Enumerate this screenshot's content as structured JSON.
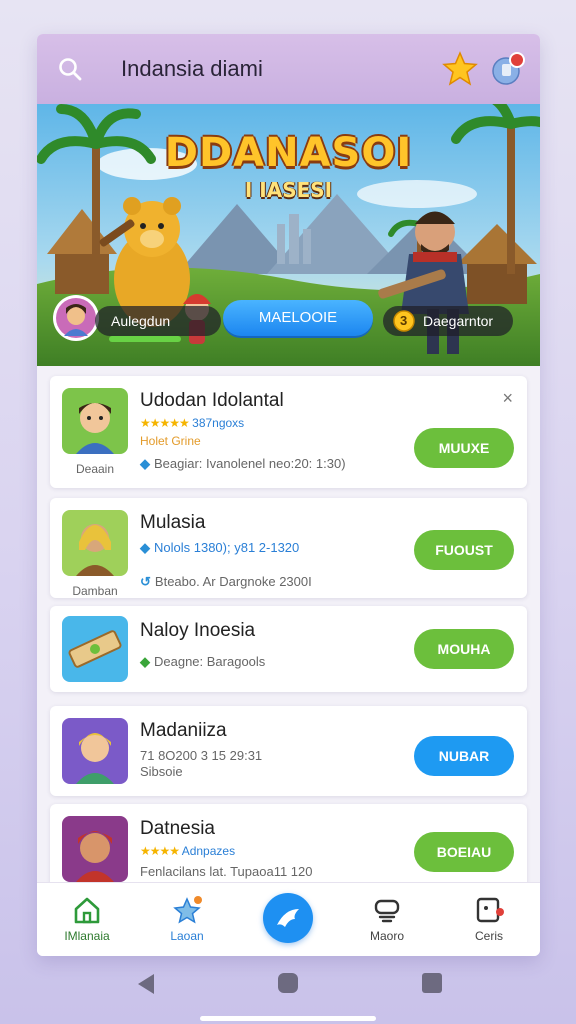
{
  "header": {
    "title": "Indansia diami",
    "search_icon": "search-icon",
    "star_icon": "star-icon",
    "badge_icon": "badge-icon"
  },
  "hero": {
    "title": "DDANASOI",
    "subtitle": "I IASESI",
    "left_pill": "Aulegdun",
    "button": "MAELOOIE",
    "right_pill": "Daegarntor",
    "coin_value": "3"
  },
  "cards": [
    {
      "title": "Udodan Idolantal",
      "rating": "387ngoxs",
      "tag": "Holet Grine",
      "meta": "Beagiar: Ivanolenel neo:20: 1:30)",
      "caption": "Deaain",
      "button": "MUUXE",
      "close": "×"
    },
    {
      "title": "Mulasia",
      "line2": "Nolols 1380); y81 2-1320",
      "meta": "Bteabo. Ar Dargnoke 2300I",
      "caption": "Damban",
      "button": "FUOUST"
    },
    {
      "title": "Naloy Inoesia",
      "meta": "Deagne: Baragools",
      "button": "MOUHA"
    },
    {
      "title": "Madaniiza",
      "line2": "71 8O200 3 15 29:31",
      "line3": "Sibsoie",
      "button": "NUBAR"
    },
    {
      "title": "Datnesia",
      "rating": "Adnpazes",
      "meta": "Fenlacilans lat. Tupaoa11 120",
      "button": "BOEIAU"
    }
  ],
  "bottom_nav": [
    {
      "label": "IMlanaia",
      "icon": "home-icon"
    },
    {
      "label": "Laoan",
      "icon": "star-badge-icon"
    },
    {
      "label": "",
      "icon": "send-icon"
    },
    {
      "label": "Maoro",
      "icon": "controller-icon"
    },
    {
      "label": "Ceris",
      "icon": "dice-icon"
    }
  ],
  "colors": {
    "green": "#6cbf3c",
    "blue": "#1e9af2",
    "header": "#d4bce8"
  }
}
